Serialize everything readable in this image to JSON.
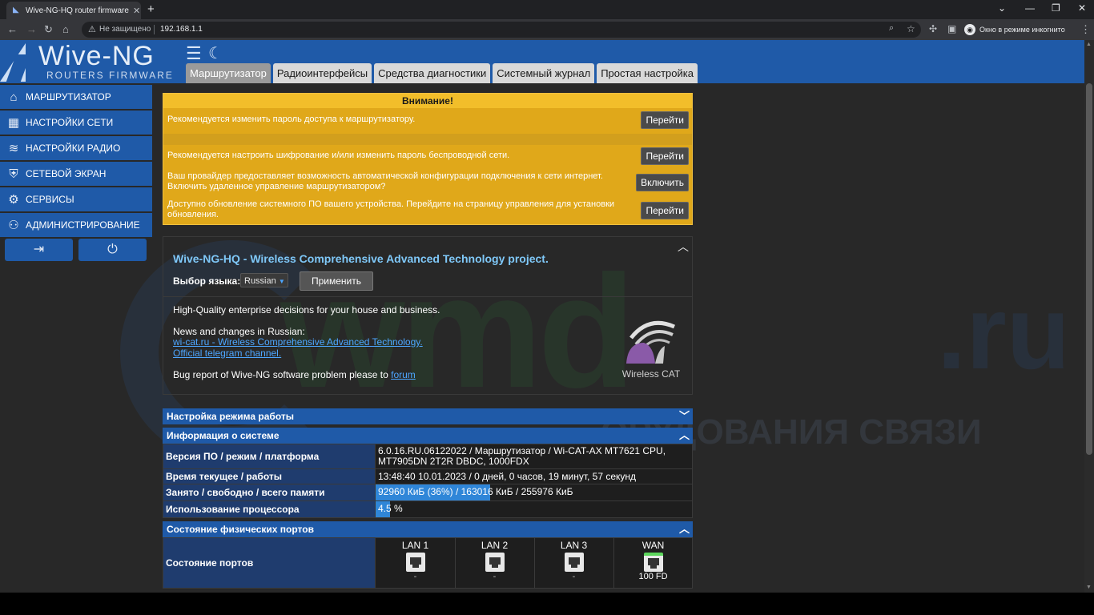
{
  "browser": {
    "tab_title": "Wive-NG-HQ router firmware - L",
    "insecure_label": "Не защищено",
    "url": "192.168.1.1",
    "incognito_label": "Окно в режиме инкогнито"
  },
  "header": {
    "logo_main": "Wive-NG",
    "logo_sub": "ROUTERS FIRMWARE",
    "menu": [
      "Маршрутизатор",
      "Радиоинтерфейсы",
      "Средства диагностики",
      "Системный журнал",
      "Простая настройка"
    ],
    "active_menu": "Маршрутизатор"
  },
  "sidebar": {
    "items": [
      {
        "label": "МАРШРУТИЗАТОР",
        "icon": "home-icon"
      },
      {
        "label": "НАСТРОЙКИ СЕТИ",
        "icon": "ethernet-icon"
      },
      {
        "label": "НАСТРОЙКИ РАДИО",
        "icon": "wifi-icon"
      },
      {
        "label": "СЕТЕВОЙ ЭКРАН",
        "icon": "firewall-icon"
      },
      {
        "label": "СЕРВИСЫ",
        "icon": "gear-icon"
      },
      {
        "label": "АДМИНИСТРИРОВАНИЕ",
        "icon": "users-gear-icon"
      }
    ]
  },
  "alert": {
    "title": "Внимание!",
    "rows": [
      {
        "text": "Рекомендуется изменить пароль доступа к маршрутизатору.",
        "button": "Перейти"
      },
      {
        "text": "Рекомендуется настроить шифрование и/или изменить пароль беспроводной сети.",
        "button": "Перейти"
      },
      {
        "text": "Ваш провайдер предоставляет возможность автоматической конфигурации подключения к сети интернет. Включить удаленное управление маршрутизатором?",
        "button": "Включить"
      },
      {
        "text": "Доступно обновление системного ПО вашего устройства. Перейдите на страницу управления для установки обновления.",
        "button": "Перейти"
      }
    ]
  },
  "info": {
    "heading": "Wive-NG-HQ - Wireless Comprehensive Advanced Technology project.",
    "lang_label": "Выбор языка:",
    "lang_value": "Russian",
    "apply_button": "Применить",
    "tagline": "High-Quality enterprise decisions for your house and business.",
    "news_label": "News and changes in Russian:",
    "link1": "wi-cat.ru - Wireless Comprehensive Advanced Technology.",
    "link2": "Official telegram channel.",
    "bug_text": "Bug report of Wive-NG software problem please to",
    "bug_link": "forum",
    "logo_text": "Wireless CAT"
  },
  "sections": {
    "mode": "Настройка режима работы",
    "sysinfo": "Информация о системе",
    "ports": "Состояние физических портов"
  },
  "sysinfo": {
    "rows": [
      {
        "label": "Версия ПО / режим / платформа",
        "value": "6.0.16.RU.06122022 / Маршрутизатор / Wi-CAT-AX MT7621 CPU, MT7905DN 2T2R DBDC, 1000FDX"
      },
      {
        "label": "Время текущее / работы",
        "value": "13:48:40 10.01.2023 / 0 дней, 0 часов, 19 минут, 57 секунд"
      }
    ],
    "memory_label": "Занято / свободно / всего памяти",
    "memory_highlight": "92960 КиБ (36%) / 163016",
    "memory_rest": " КиБ / 255976 КиБ",
    "memory_percent": 36,
    "cpu_label": "Использование процессора",
    "cpu_value": "4.5",
    "cpu_unit": " %",
    "cpu_percent": 4.5
  },
  "ports": {
    "row_label": "Состояние портов",
    "items": [
      {
        "name": "LAN 1",
        "status": "-"
      },
      {
        "name": "LAN 2",
        "status": "-"
      },
      {
        "name": "LAN 3",
        "status": "-"
      },
      {
        "name": "WAN",
        "status": "100 FD"
      }
    ]
  },
  "watermark": {
    "main": "wmd",
    "ru": ".ru",
    "sub": "ОРУДОВАНИЯ СВЯЗИ"
  }
}
